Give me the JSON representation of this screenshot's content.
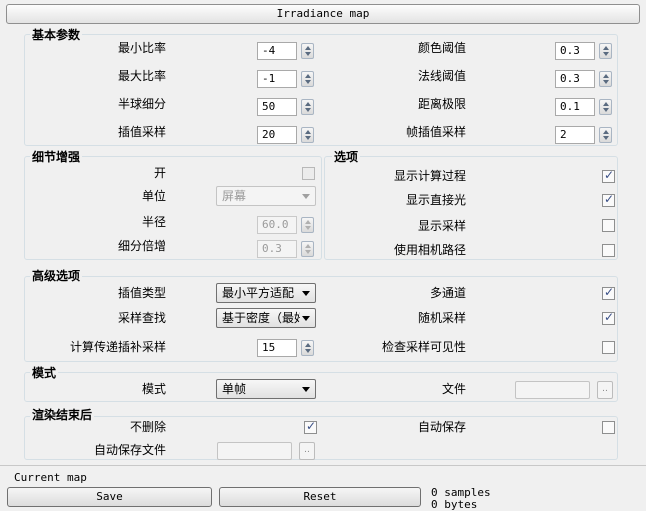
{
  "title": "Irradiance map",
  "basic": {
    "title": "基本参数",
    "left": [
      {
        "label": "最小比率",
        "value": "-4"
      },
      {
        "label": "最大比率",
        "value": "-1"
      },
      {
        "label": "半球细分",
        "value": "50"
      },
      {
        "label": "插值采样",
        "value": "20"
      }
    ],
    "right": [
      {
        "label": "颜色阈值",
        "value": "0.3"
      },
      {
        "label": "法线阈值",
        "value": "0.3"
      },
      {
        "label": "距离极限",
        "value": "0.1"
      },
      {
        "label": "帧插值采样",
        "value": "2"
      }
    ]
  },
  "detail": {
    "title": "细节增强",
    "on_label": "开",
    "on_checked": false,
    "unit_label": "单位",
    "unit_value": "屏幕",
    "radius_label": "半径",
    "radius_value": "60.0",
    "mult_label": "细分倍增",
    "mult_value": "0.3"
  },
  "options": {
    "title": "选项",
    "items": [
      {
        "label": "显示计算过程",
        "checked": true
      },
      {
        "label": "显示直接光",
        "checked": true
      },
      {
        "label": "显示采样",
        "checked": false
      },
      {
        "label": "使用相机路径",
        "checked": false
      }
    ]
  },
  "advanced": {
    "title": "高级选项",
    "interp_label": "插值类型",
    "interp_value": "最小平方适配",
    "lookup_label": "采样查找",
    "lookup_value": "基于密度（最好",
    "calc_label": "计算传递插补采样",
    "calc_value": "15",
    "multipass_label": "多通道",
    "multipass_checked": true,
    "random_label": "随机采样",
    "random_checked": true,
    "check_label": "检查采样可见性",
    "check_checked": false
  },
  "mode": {
    "title": "模式",
    "mode_label": "模式",
    "mode_value": "单帧",
    "file_label": "文件",
    "file_value": "",
    "browse_label": ".."
  },
  "after": {
    "title": "渲染结束后",
    "nodelete_label": "不删除",
    "nodelete_checked": true,
    "autosave_label": "自动保存",
    "autosave_checked": false,
    "autosave_file_label": "自动保存文件",
    "autosave_file_value": "",
    "browse_label": ".."
  },
  "current_map": {
    "title": "Current map",
    "save_label": "Save",
    "reset_label": "Reset",
    "samples": "0 samples",
    "bytes": "0 bytes"
  }
}
